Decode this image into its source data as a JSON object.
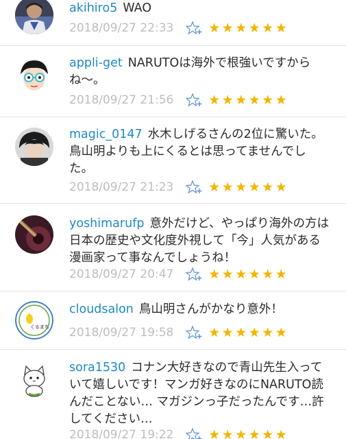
{
  "comments": [
    {
      "user": "akihiro5",
      "text": "WAO",
      "time": "2018/09/27 22:33",
      "avatar": "avatar-man-photo",
      "star_count": 6
    },
    {
      "user": "appli-get",
      "text": "NARUTOは海外で根強いですからね〜。",
      "time": "2018/09/27 21:56",
      "avatar": "avatar-glasses-illustration",
      "star_count": 6
    },
    {
      "user": "magic_0147",
      "text": "水木しげるさんの2位に驚いた。鳥山明よりも上にくるとは思ってませんでした。",
      "time": "2018/09/27 21:23",
      "avatar": "avatar-face-photo",
      "star_count": 6
    },
    {
      "user": "yoshimarufp",
      "text": "意外だけど、やっぱり海外の方は日本の歴史や文化度外視して「今」人気がある漫画家って事なんでしょうね！",
      "time": "2018/09/27 20:47",
      "avatar": "avatar-guitar-photo",
      "star_count": 6
    },
    {
      "user": "cloudsalon",
      "text": "鳥山明さんがかなり意外！",
      "time": "2018/09/27 19:58",
      "avatar": "avatar-cloud-salon-logo",
      "star_count": 6,
      "avatar_text": "くるまち"
    },
    {
      "user": "sora1530",
      "text": "コナン大好きなので青山先生入っていて嬉しいです！マンガ好きなのにNARUTO読んだことない… マガジンっ子だったんです…許してください…",
      "time": "2018/09/27 19:22",
      "avatar": "avatar-cat-illustration",
      "star_count": 6
    }
  ],
  "star_glyph": "★",
  "colors": {
    "username": "#1e88c7",
    "star": "#f2b500",
    "timestamp": "#bdbdbd",
    "add_star_icon": "#5b8fd6"
  }
}
